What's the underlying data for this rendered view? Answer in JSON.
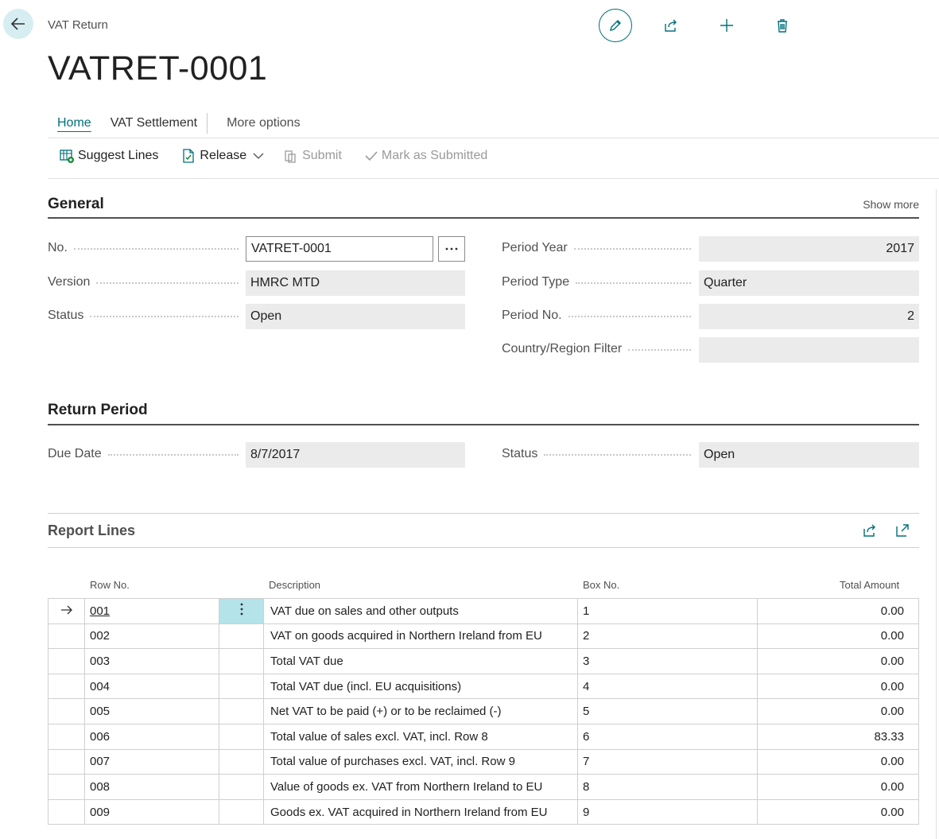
{
  "header": {
    "caption": "VAT Return",
    "title": "VATRET-0001"
  },
  "tabs": {
    "home": "Home",
    "vat_settlement": "VAT Settlement",
    "more": "More options"
  },
  "actions": {
    "suggest_lines": "Suggest Lines",
    "release": "Release",
    "submit": "Submit",
    "mark_as_submitted": "Mark as Submitted"
  },
  "general": {
    "title": "General",
    "show_more": "Show more",
    "no_label": "No.",
    "no_value": "VATRET-0001",
    "version_label": "Version",
    "version_value": "HMRC MTD",
    "status_label": "Status",
    "status_value": "Open",
    "period_year_label": "Period Year",
    "period_year_value": "2017",
    "period_type_label": "Period Type",
    "period_type_value": "Quarter",
    "period_no_label": "Period No.",
    "period_no_value": "2",
    "country_filter_label": "Country/Region Filter",
    "country_filter_value": ""
  },
  "return_period": {
    "title": "Return Period",
    "due_date_label": "Due Date",
    "due_date_value": "8/7/2017",
    "status_label": "Status",
    "status_value": "Open"
  },
  "report_lines": {
    "title": "Report Lines",
    "columns": {
      "row_no": "Row No.",
      "description": "Description",
      "box_no": "Box No.",
      "total_amount": "Total Amount"
    },
    "rows": [
      {
        "row_no": "001",
        "description": "VAT due on sales and other outputs",
        "box_no": "1",
        "amount": "0.00"
      },
      {
        "row_no": "002",
        "description": "VAT on goods acquired in Northern Ireland from EU",
        "box_no": "2",
        "amount": "0.00"
      },
      {
        "row_no": "003",
        "description": "Total VAT due",
        "box_no": "3",
        "amount": "0.00"
      },
      {
        "row_no": "004",
        "description": "Total VAT due (incl. EU acquisitions)",
        "box_no": "4",
        "amount": "0.00"
      },
      {
        "row_no": "005",
        "description": "Net VAT to be paid (+) or to be reclaimed (-)",
        "box_no": "5",
        "amount": "0.00"
      },
      {
        "row_no": "006",
        "description": "Total value of sales excl. VAT, incl. Row 8",
        "box_no": "6",
        "amount": "83.33"
      },
      {
        "row_no": "007",
        "description": "Total value of purchases excl. VAT, incl. Row 9",
        "box_no": "7",
        "amount": "0.00"
      },
      {
        "row_no": "008",
        "description": "Value of goods ex. VAT from Northern Ireland to EU",
        "box_no": "8",
        "amount": "0.00"
      },
      {
        "row_no": "009",
        "description": "Goods ex. VAT acquired in Northern Ireland from EU",
        "box_no": "9",
        "amount": "0.00"
      }
    ]
  },
  "colors": {
    "accent": "#00707a",
    "selected_cell": "#b4e3ea",
    "readonly_field": "#ebebeb"
  }
}
